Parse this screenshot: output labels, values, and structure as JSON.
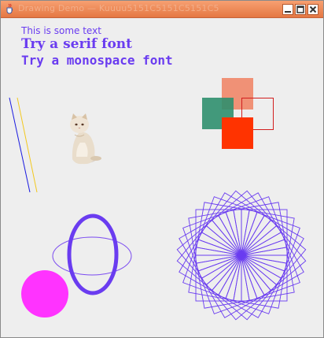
{
  "window": {
    "title": "Drawing Demo — Kuuuu5151C5151C5151C5",
    "controls": [
      "minimize",
      "maximize",
      "close"
    ]
  },
  "texts": {
    "sans": "This is some text",
    "serif": "Try a serif font",
    "mono": "Try a monospace font"
  },
  "icons": {
    "app": "java-cup-icon",
    "image": "kitten-photo"
  },
  "colors": {
    "text": "#6a3cf0",
    "shape_stroke": "#6a3cf0",
    "blue_line": "#1a1ae0",
    "yellow_line": "#f2c81e",
    "salmon_square": "#f08060",
    "green_square": "#2f8f6e",
    "red_outline": "#d21e1e",
    "red_square": "#ff3300",
    "magenta_circle": "#ff33ff"
  }
}
